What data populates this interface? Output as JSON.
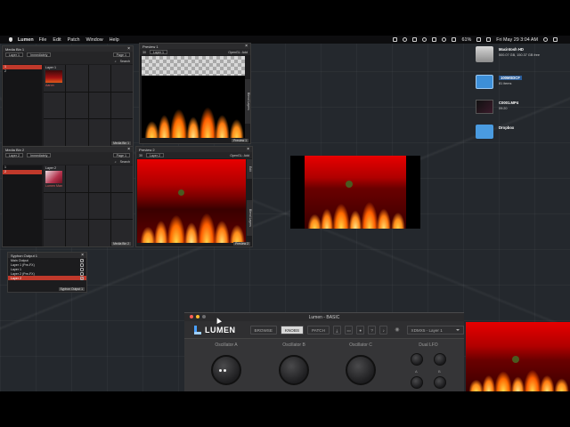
{
  "menubar": {
    "app": "Lumen",
    "items": [
      "File",
      "Edit",
      "Patch",
      "Window",
      "Help"
    ],
    "battery": "61%",
    "clock": "Fri May 29  3:04 AM"
  },
  "media_bin_1": {
    "title": "Media Bin 1",
    "layer_select": "Layer 1",
    "mode_select": "Immediately",
    "page_select": "Page 1",
    "search_placeholder": "Search",
    "layers": [
      "1",
      "2"
    ],
    "clip_header": "Layer 1",
    "clip_name": "Aaron",
    "footer": "Media Bin 1"
  },
  "media_bin_2": {
    "title": "Media Bin 2",
    "layer_select": "Layer 2",
    "mode_select": "Immediately",
    "page_select": "Page 1",
    "search_placeholder": "Search",
    "layers": [
      "1",
      "2"
    ],
    "clip_header": "Layer 2",
    "clip_name": "Lumen Man",
    "footer": "Media Bin 2"
  },
  "preview_1": {
    "title": "Preview 1",
    "layer_num": "30",
    "layer_select": "Layer 1",
    "blend": "OpenGL: Add",
    "side_tab": "Blend Layers",
    "footer": "Preview 1"
  },
  "preview_2": {
    "title": "Preview 2",
    "layer_num": "30",
    "layer_select": "Layer 2",
    "blend": "OpenGL: Add",
    "side_tab": "Blend Layers",
    "side_tab_2": "Edit",
    "footer": "Preview 2"
  },
  "syphon": {
    "title": "Syphon Output 1",
    "rows": [
      {
        "label": "Main Output",
        "checked": true
      },
      {
        "label": "Layer 1 (Pre-FX)",
        "checked": false
      },
      {
        "label": "Layer 1",
        "checked": false
      },
      {
        "label": "Layer 2 (Pre-FX)",
        "checked": false
      },
      {
        "label": "Layer 2",
        "checked": true
      }
    ],
    "footer": "Syphon Output 1"
  },
  "desktop": [
    {
      "label": "Macintosh HD",
      "sub": "500.07 GB, 150.37 GB free",
      "icon": "hard-drive-icon"
    },
    {
      "label": "100MSDCF",
      "sub": "81 items",
      "icon": "folder-icon"
    },
    {
      "label": "C0001.MP4",
      "sub": "09:20",
      "icon": "video-file-icon"
    },
    {
      "label": "Dropbox",
      "sub": "",
      "icon": "dropbox-folder-icon"
    }
  ],
  "lumen_window": {
    "title": "Lumen - BASIC",
    "logo": "LUMEN",
    "tabs": [
      "BROWSE",
      "KNOBS",
      "PATCH"
    ],
    "active_tab": "KNOBS",
    "device_select": "XDMX5 - Layer 1",
    "knobs": [
      "Oscillator A",
      "Oscillator B",
      "Oscillator C",
      "Dual LFO"
    ],
    "lfo_labels": [
      "A",
      "B"
    ]
  },
  "colors": {
    "accent": "#c0392b",
    "lumen_blue": "#4aa0ff"
  }
}
